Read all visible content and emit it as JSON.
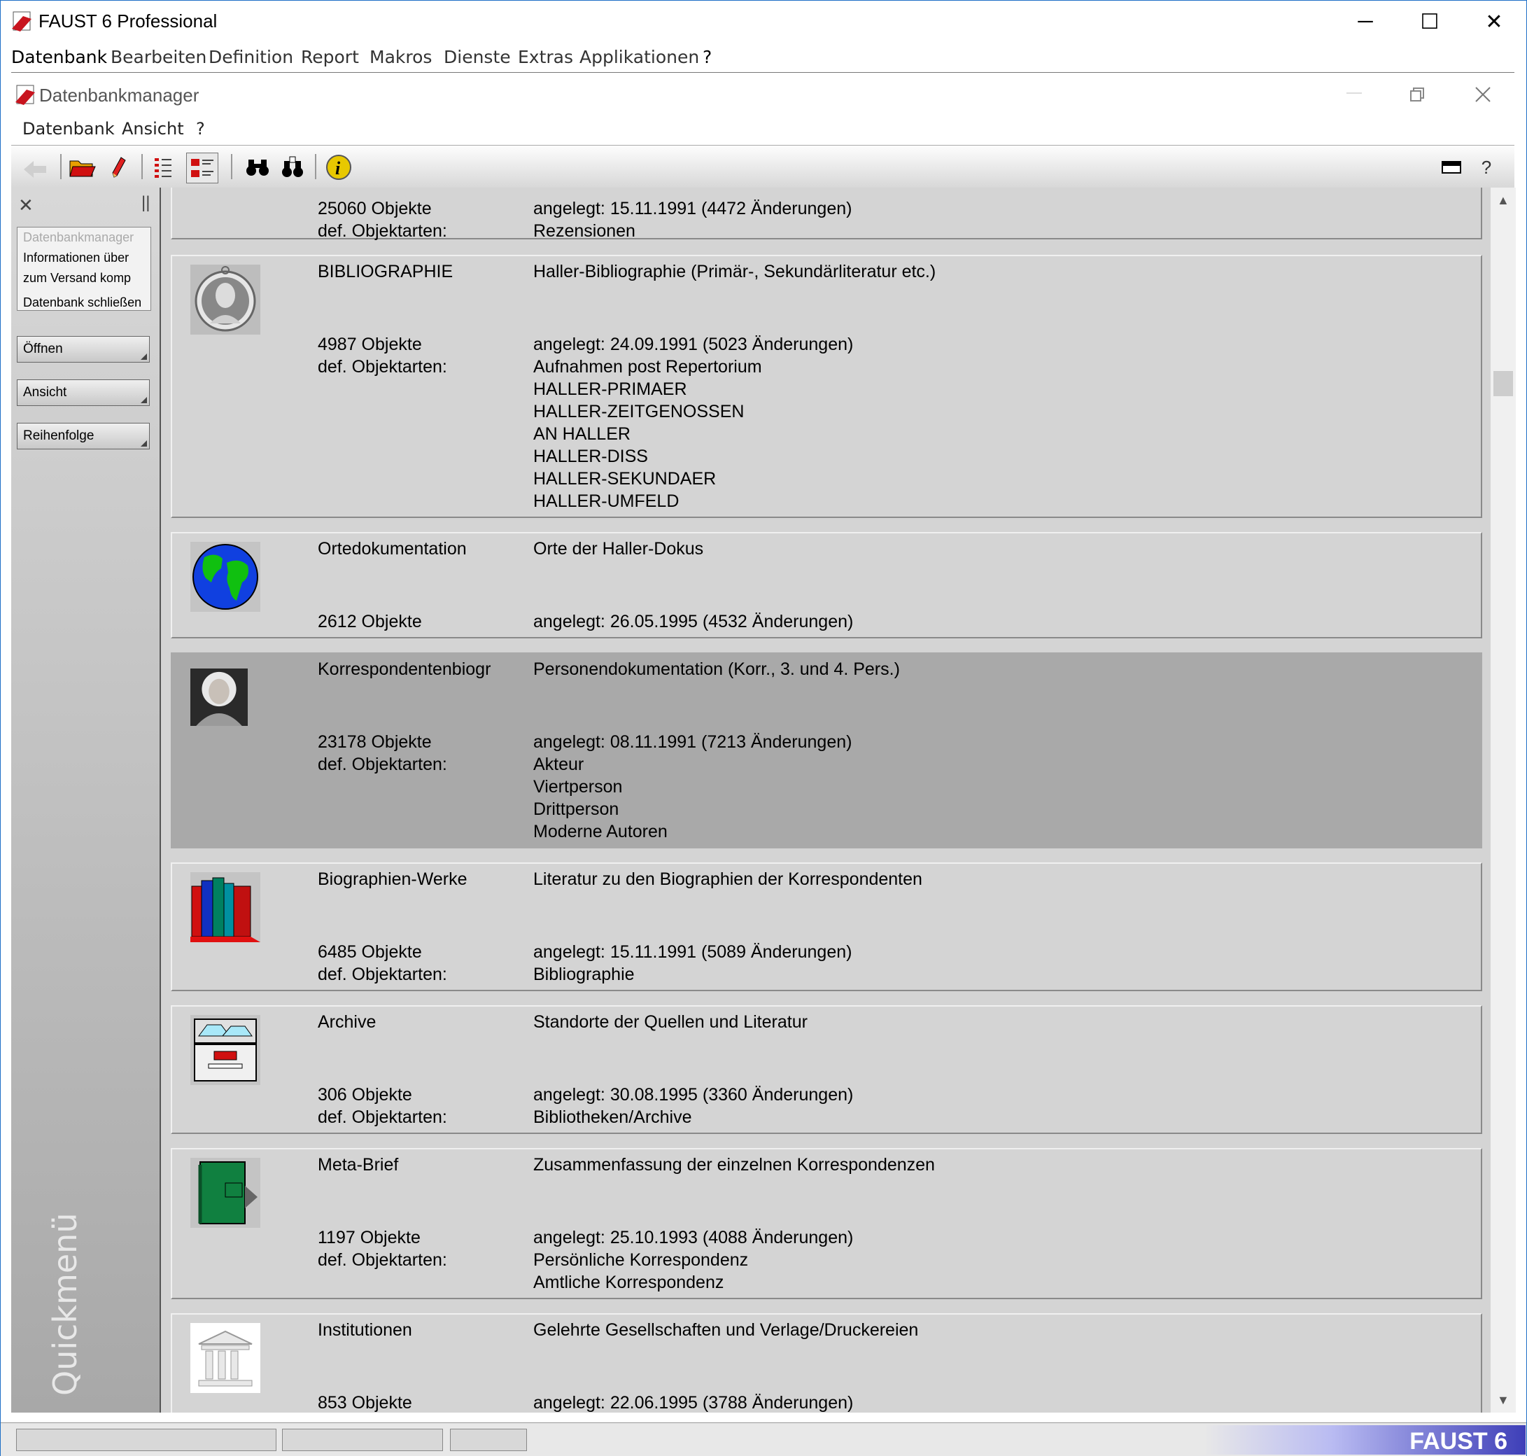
{
  "app": {
    "title": "FAUST 6 Professional",
    "window_buttons": {
      "minimize": "─",
      "maximize": "☐",
      "close": "✕"
    }
  },
  "menu": [
    "Datenbank",
    "Bearbeiten",
    "Definition",
    "Report",
    "Makros",
    "Dienste",
    "Extras",
    "Applikationen",
    "?"
  ],
  "dbmanager": {
    "title": "Datenbankmanager",
    "menu": [
      "Datenbank",
      "Ansicht",
      "?"
    ],
    "toolbar_icons": [
      "back-icon",
      "open-folder-icon",
      "edit-pencil-icon",
      "list-view-icon",
      "detail-view-icon",
      "binoculars-icon",
      "binoculars-filter-icon",
      "info-icon",
      "panel-icon",
      "help-icon"
    ],
    "help": "?"
  },
  "quickmenu": {
    "list": [
      "Datenbankmanager",
      "Informationen über",
      "zum Versand komp",
      "Datenbank schließen"
    ],
    "buttons": [
      "Öffnen",
      "Ansicht",
      "Reihenfolge"
    ],
    "watermark": "Quickmenü",
    "close": "✕",
    "pin": "||"
  },
  "databases": [
    {
      "name": "",
      "description": "",
      "count": "25060 Objekte",
      "created": "angelegt: 15.11.1991 (4472 Änderungen)",
      "types_label": "def. Objektarten:",
      "types": [
        "Rezensionen"
      ],
      "icon": "none",
      "selected": false
    },
    {
      "name": "BIBLIOGRAPHIE",
      "description": "Haller-Bibliographie (Primär-, Sekundärliteratur etc.)",
      "count": "4987 Objekte",
      "created": "angelegt: 24.09.1991 (5023 Änderungen)",
      "types_label": "def. Objektarten:",
      "types": [
        "Aufnahmen post Repertorium",
        "HALLER-PRIMAER",
        "HALLER-ZEITGENOSSEN",
        "AN HALLER",
        "HALLER-DISS",
        "HALLER-SEKUNDAER",
        "HALLER-UMFELD"
      ],
      "icon": "medallion-portrait-icon",
      "selected": false
    },
    {
      "name": "Ortedokumentation",
      "description": "Orte der Haller-Dokus",
      "count": "2612 Objekte",
      "created": "angelegt: 26.05.1995 (4532 Änderungen)",
      "types_label": "",
      "types": [],
      "icon": "globe-icon",
      "selected": false
    },
    {
      "name": "Korrespondentenbiogr",
      "description": "Personendokumentation (Korr., 3. und 4. Pers.)",
      "count": "23178 Objekte",
      "created": "angelegt: 08.11.1991 (7213 Änderungen)",
      "types_label": "def. Objektarten:",
      "types": [
        "Akteur",
        "Viertperson",
        "Drittperson",
        "Moderne Autoren"
      ],
      "icon": "portrait-icon",
      "selected": true
    },
    {
      "name": "Biographien-Werke",
      "description": "Literatur zu den Biographien der Korrespondenten",
      "count": "6485 Objekte",
      "created": "angelegt: 15.11.1991 (5089 Änderungen)",
      "types_label": "def. Objektarten:",
      "types": [
        "Bibliographie"
      ],
      "icon": "books-icon",
      "selected": false
    },
    {
      "name": "Archive",
      "description": "Standorte der Quellen und Literatur",
      "count": "306 Objekte",
      "created": "angelegt: 30.08.1995 (3360 Änderungen)",
      "types_label": "def. Objektarten:",
      "types": [
        "Bibliotheken/Archive"
      ],
      "icon": "file-cabinet-icon",
      "selected": false
    },
    {
      "name": "Meta-Brief",
      "description": "Zusammenfassung der einzelnen Korrespondenzen",
      "count": "1197 Objekte",
      "created": "angelegt: 25.10.1993 (4088 Änderungen)",
      "types_label": "def. Objektarten:",
      "types": [
        "Persönliche Korrespondenz",
        "Amtliche Korrespondenz"
      ],
      "icon": "green-binder-icon",
      "selected": false
    },
    {
      "name": "Institutionen",
      "description": "Gelehrte Gesellschaften und Verlage/Druckereien",
      "count": "853 Objekte",
      "created": "angelegt: 22.06.1995 (3788 Änderungen)",
      "types_label": "",
      "types": [],
      "icon": "institution-building-icon",
      "selected": false
    }
  ],
  "status": {
    "brand": "FAUST 6"
  },
  "scroll": {
    "up": "▲",
    "down": "▼"
  }
}
